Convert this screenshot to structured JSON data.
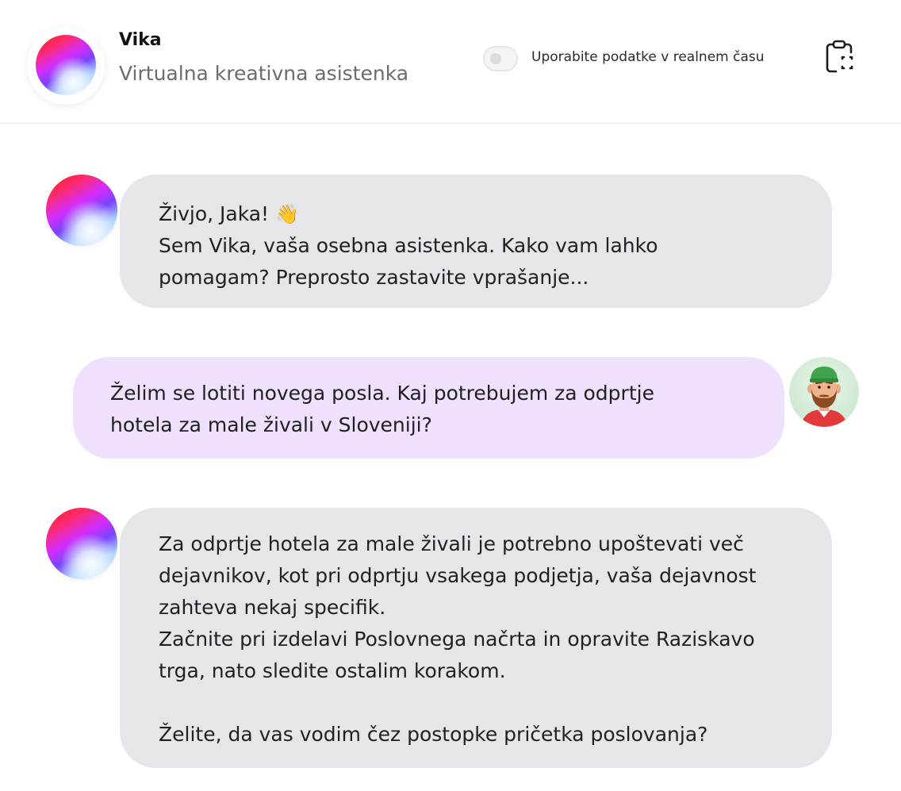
{
  "header": {
    "assistant_name": "Vika",
    "assistant_subtitle": "Virtualna kreativna asistenka",
    "realtime_toggle": {
      "label": "Uporabite podatke v realnem času",
      "enabled": false
    },
    "clipboard_icon": "clipboard-capture-icon"
  },
  "messages": [
    {
      "role": "assistant",
      "avatar": "assistant-orb-avatar",
      "lines": [
        "Živjo, Jaka!",
        "Sem Vika, vaša osebna asistenka. Kako vam lahko",
        "pomagam? Preprosto zastavite vprašanje..."
      ],
      "emoji": "👋"
    },
    {
      "role": "user",
      "avatar": "user-avatar",
      "lines": [
        "Želim se lotiti novega posla. Kaj potrebujem za odprtje",
        "hotela za male živali v Sloveniji?"
      ]
    },
    {
      "role": "assistant",
      "avatar": "assistant-orb-avatar",
      "lines": [
        "Za odprtje hotela za male živali je potrebno upoštevati več",
        "dejavnikov, kot pri odprtju vsakega podjetja, vaša dejavnost",
        "zahteva nekaj specifik.",
        "Začnite pri izdelavi Poslovnega načrta in opravite Raziskavo",
        "trga, nato sledite ostalim korakom.",
        "",
        "Želite, da vas vodim čez postopke pričetka poslovanja?"
      ]
    }
  ],
  "colors": {
    "assistant_bubble": "#e6e6ea",
    "user_bubble": "#efe0fb",
    "header_border": "#ececee"
  }
}
